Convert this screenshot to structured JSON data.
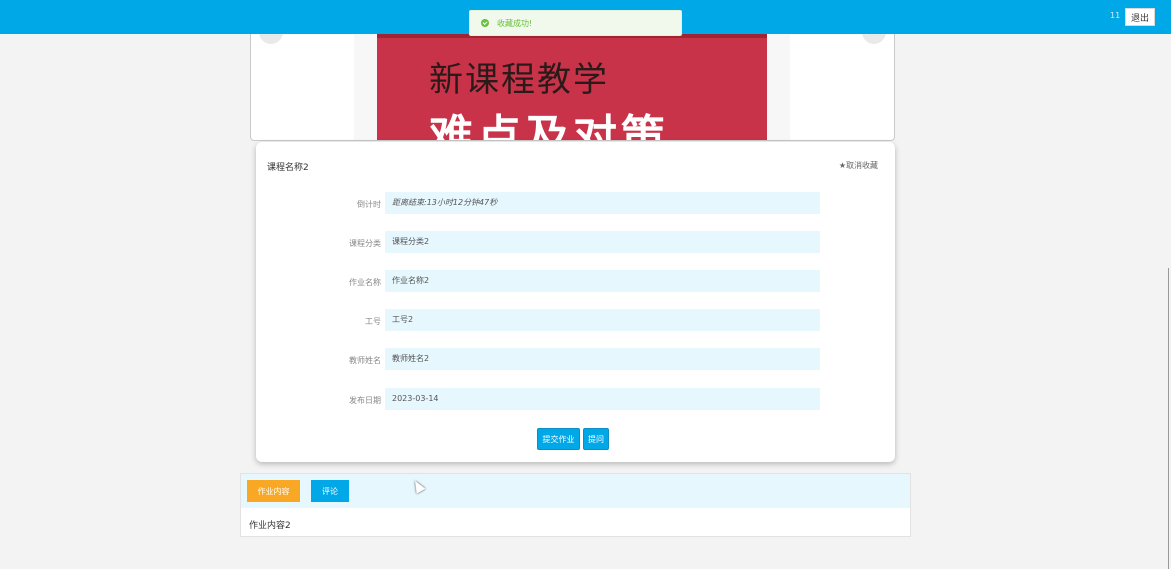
{
  "header": {
    "user_name": "11",
    "logout_label": "退出"
  },
  "toast": {
    "message": "收藏成功!"
  },
  "carousel": {
    "book_title_line1": "新课程教学",
    "book_title_line2": "难点及对策"
  },
  "detail": {
    "course_name": "课程名称2",
    "favorite_label": "★取消收藏",
    "fields": [
      {
        "label": "倒计时",
        "value": "距离结束:13小时12分钟47秒"
      },
      {
        "label": "课程分类",
        "value": "课程分类2"
      },
      {
        "label": "作业名称",
        "value": "作业名称2"
      },
      {
        "label": "工号",
        "value": "工号2"
      },
      {
        "label": "教师姓名",
        "value": "教师姓名2"
      },
      {
        "label": "发布日期",
        "value": "2023-03-14"
      }
    ],
    "submit_label": "提交作业",
    "question_label": "提问"
  },
  "content": {
    "tabs": [
      {
        "label": "作业内容"
      },
      {
        "label": "评论"
      }
    ],
    "text": "作业内容2"
  }
}
